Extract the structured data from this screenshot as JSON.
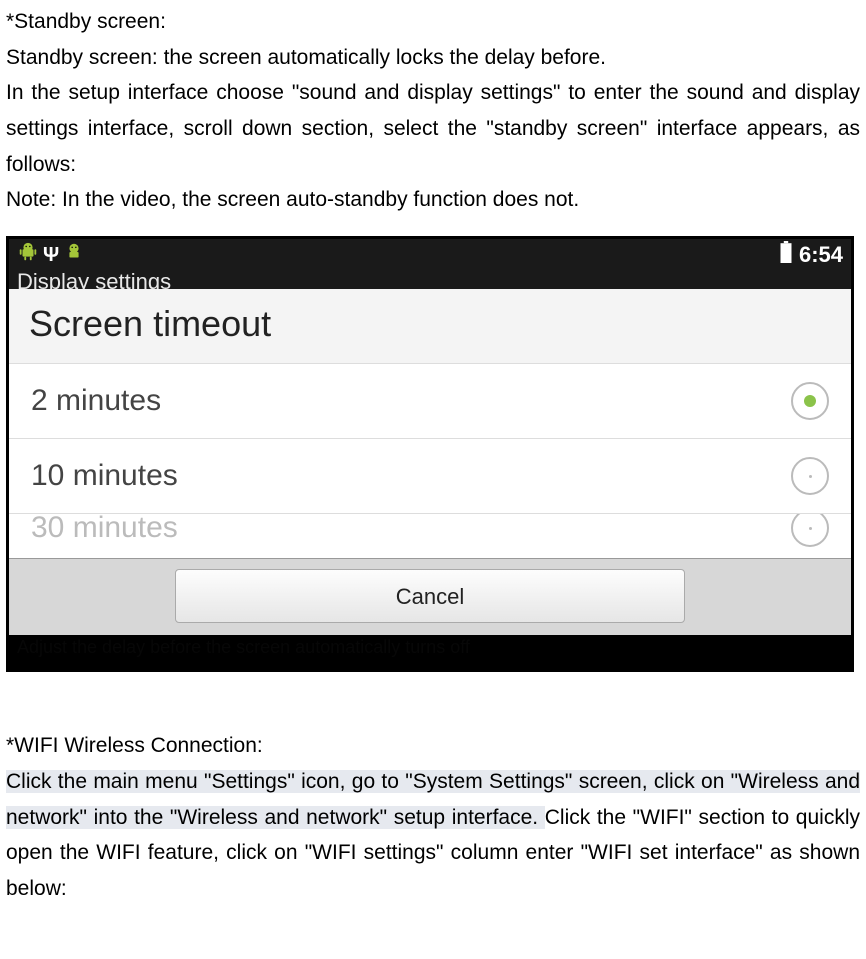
{
  "doc": {
    "para1": "*Standby screen:",
    "para2": "Standby screen: the screen automatically locks the delay before.",
    "para3": "In the setup interface choose \"sound and display settings\" to enter the sound and display settings interface, scroll down section, select the \"standby screen\" interface appears, as follows:",
    "para4": "Note: In the video, the screen auto-standby function does not.",
    "para5": "*WIFI Wireless Connection:",
    "para6a": "Click the main menu \"Settings\" icon, go to \"System Settings\" screen, click on \"Wireless and network\" into the \"Wireless and network\" setup interface. ",
    "para6b": "Click the \"WIFI\" section to quickly open the WIFI feature, click on \"WIFI settings\" column enter \"WIFI set interface\" as shown below:"
  },
  "screenshot": {
    "statusbar": {
      "clock": "6:54"
    },
    "bg_title": "Display settings",
    "dialog": {
      "title": "Screen timeout",
      "options": [
        {
          "label": "2 minutes",
          "selected": true
        },
        {
          "label": "10 minutes",
          "selected": false
        },
        {
          "label": "30 minutes",
          "selected": false
        }
      ],
      "cancel_label": "Cancel"
    },
    "bg_bottom": "Adjust the delay before the screen automatically turns off"
  }
}
